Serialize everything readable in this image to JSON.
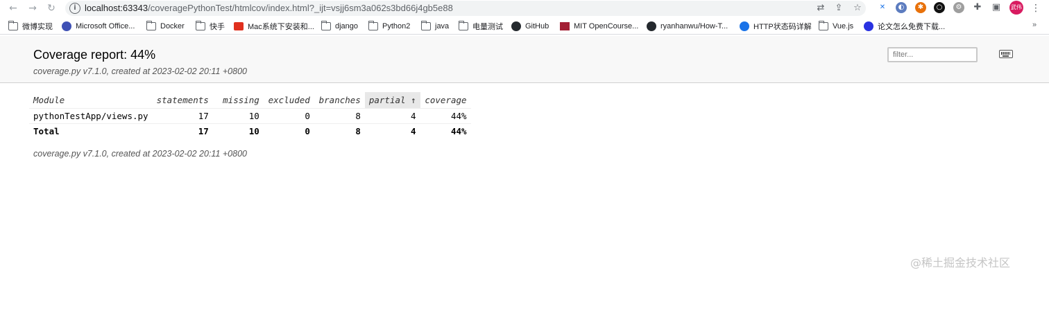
{
  "browser": {
    "url_host": "localhost:63343",
    "url_path": "/coveragePythonTest/htmlcov/index.html?_ijt=vsjj6sm3a062s3bd66j4gb5e88",
    "avatar_text": "武伟",
    "bookmarks": [
      {
        "label": "微博实现",
        "icon": "folder-icon"
      },
      {
        "label": "Microsoft Office...",
        "icon": "office-icon"
      },
      {
        "label": "Docker",
        "icon": "folder-icon"
      },
      {
        "label": "快手",
        "icon": "folder-icon"
      },
      {
        "label": "Mac系统下安装和...",
        "icon": "csdn-icon"
      },
      {
        "label": "django",
        "icon": "folder-icon"
      },
      {
        "label": "Python2",
        "icon": "folder-icon"
      },
      {
        "label": "java",
        "icon": "folder-icon"
      },
      {
        "label": "电量测试",
        "icon": "folder-icon"
      },
      {
        "label": "GitHub",
        "icon": "github-icon"
      },
      {
        "label": "MIT OpenCourse...",
        "icon": "mit-icon"
      },
      {
        "label": "ryanhanwu/How-T...",
        "icon": "github-icon"
      },
      {
        "label": "HTTP状态码详解",
        "icon": "c-icon"
      },
      {
        "label": "Vue.js",
        "icon": "folder-icon"
      },
      {
        "label": "论文怎么免费下载...",
        "icon": "baidu-icon"
      }
    ],
    "more_label": "»"
  },
  "report": {
    "title": "Coverage report: 44%",
    "subtitle": "coverage.py v7.1.0, created at 2023-02-02 20:11 +0800",
    "filter_placeholder": "filter...",
    "columns": {
      "module": "Module",
      "statements": "statements",
      "missing": "missing",
      "excluded": "excluded",
      "branches": "branches",
      "partial": "partial ↑",
      "coverage": "coverage"
    },
    "rows": [
      {
        "module": "pythonTestApp/views.py",
        "statements": "17",
        "missing": "10",
        "excluded": "0",
        "branches": "8",
        "partial": "4",
        "coverage": "44%"
      }
    ],
    "total": {
      "module": "Total",
      "statements": "17",
      "missing": "10",
      "excluded": "0",
      "branches": "8",
      "partial": "4",
      "coverage": "44%"
    },
    "footer": "coverage.py v7.1.0, created at 2023-02-02 20:11 +0800"
  },
  "watermark": "@稀土掘金技术社区",
  "colors": {
    "accent_avatar": "#d81b60",
    "header_bg": "#f8f8f8",
    "sorted_header_bg": "#e8e8e8"
  }
}
